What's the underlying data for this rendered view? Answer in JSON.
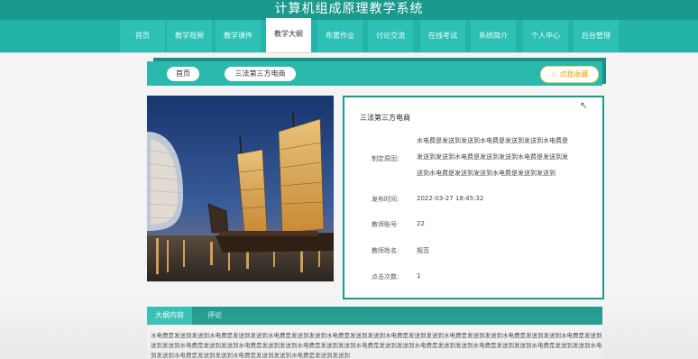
{
  "site": {
    "title": "计算机组成原理教学系统"
  },
  "nav": {
    "items": [
      {
        "label": "首页"
      },
      {
        "label": "教学视频"
      },
      {
        "label": "教学课件"
      },
      {
        "label": "教学大纲"
      },
      {
        "label": "布置作业"
      },
      {
        "label": "讨论交流"
      },
      {
        "label": "在线考试"
      },
      {
        "label": "系统简介"
      },
      {
        "label": "个人中心"
      },
      {
        "label": "后台管理"
      }
    ],
    "active": "教学大纲"
  },
  "breadcrumb": {
    "home": "首页",
    "current": "三法第三方电商",
    "favorite": "☆ 点我收藏"
  },
  "detail": {
    "title": "三法第三方电商",
    "reason_label": "制定原因:",
    "reason_lines": [
      "水电费是发送到发送到水电费是发送到发送到水电费是",
      "发送到发送到水电费是发送到发送到水电费是发送到发",
      "送到水电费是发送到发送到水电费是发送到发送到"
    ],
    "published_label": "发布时间:",
    "published": "2022-03-27 18:45:32",
    "teacher_account_label": "教师账号:",
    "teacher_account": "22",
    "teacher_name_label": "教师姓名:",
    "teacher_name": "规范",
    "clicks_label": "点击次数:",
    "clicks": "1"
  },
  "tabs": {
    "outline": "大纲内容",
    "comments": "评论"
  },
  "outline_text": [
    "水电费是发送到发送到水电费是发送到发送到水电费是发送到发送到水电费是发送到发送到水电费是发送到发送到水电费是发送到发送到水电费是发送到发送到水电费是发送到发送到",
    "送到发送到水电费是发送到发送到水电费是发送到发送到水电费是发送到发送到水电费是发送到发送到水电费是发送到发送到水电费是发送到发送到水电费是发送到发送到水电费是发",
    "到发送到水电费是发送到发送到水电费是发送到发送到水电费是发送到发送到"
  ]
}
